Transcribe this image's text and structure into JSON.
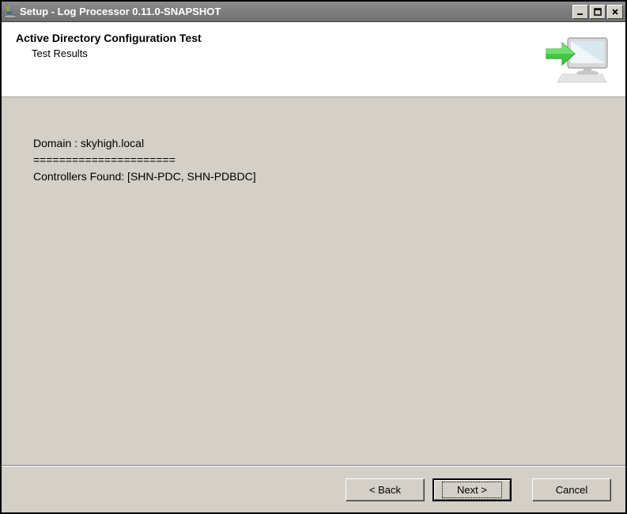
{
  "titlebar": {
    "title": "Setup - Log Processor 0.11.0-SNAPSHOT"
  },
  "header": {
    "title": "Active Directory Configuration Test",
    "subtitle": "Test Results"
  },
  "results": {
    "line1": "Domain : skyhigh.local",
    "line2": "======================",
    "line3": "Controllers Found: [SHN-PDC, SHN-PDBDC]"
  },
  "buttons": {
    "back": "< Back",
    "next": "Next >",
    "cancel": "Cancel"
  }
}
